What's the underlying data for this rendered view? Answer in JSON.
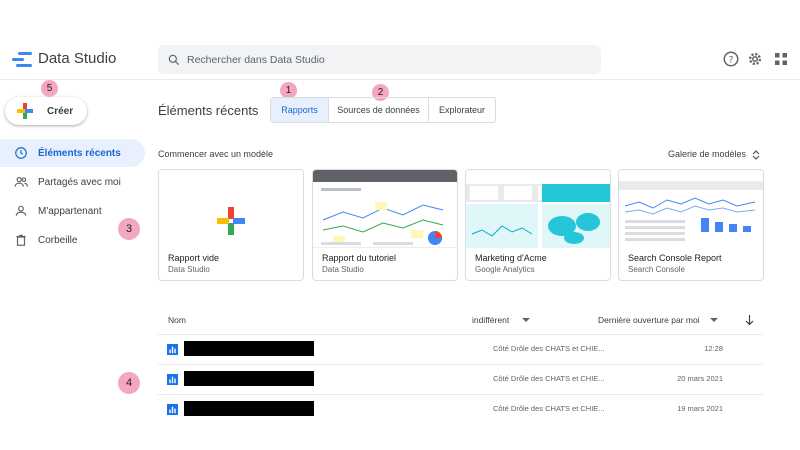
{
  "header": {
    "app_title": "Data Studio",
    "search_placeholder": "Rechercher dans Data Studio"
  },
  "sidebar": {
    "create_label": "Créer",
    "items": [
      {
        "label": "Éléments récents",
        "icon": "clock-icon",
        "active": true
      },
      {
        "label": "Partagés avec moi",
        "icon": "people-icon",
        "active": false
      },
      {
        "label": "M'appartenant",
        "icon": "person-icon",
        "active": false
      },
      {
        "label": "Corbeille",
        "icon": "trash-icon",
        "active": false
      }
    ]
  },
  "main": {
    "title": "Éléments récents",
    "tabs": [
      {
        "label": "Rapports",
        "active": true
      },
      {
        "label": "Sources de données",
        "active": false
      },
      {
        "label": "Explorateur",
        "active": false
      }
    ],
    "templates_heading": "Commencer avec un modèle",
    "gallery_label": "Galerie de modèles",
    "templates": [
      {
        "name": "Rapport vide",
        "source": "Data Studio"
      },
      {
        "name": "Rapport du tutoriel",
        "source": "Data Studio"
      },
      {
        "name": "Marketing d'Acme",
        "source": "Google Analytics"
      },
      {
        "name": "Search Console Report",
        "source": "Search Console"
      }
    ],
    "table": {
      "col_name": "Nom",
      "col_owner": "indifférent",
      "col_date": "Dernière ouverture par moi",
      "rows": [
        {
          "owner": "Côté Drôle des CHATS et CHIE...",
          "date": "12:28"
        },
        {
          "owner": "Côté Drôle des CHATS et CHIE...",
          "date": "20 mars 2021"
        },
        {
          "owner": "Côté Drôle des CHATS et CHIE...",
          "date": "19 mars 2021"
        }
      ]
    }
  },
  "annotations": [
    "1",
    "2",
    "3",
    "4",
    "5"
  ],
  "colors": {
    "accent_blue": "#1967d2",
    "active_bg": "#e8f0fe",
    "badge_pink": "#f4a7c0",
    "google_blue": "#4285f4",
    "google_red": "#ea4335",
    "google_yellow": "#fbbc04",
    "google_green": "#34a853"
  }
}
